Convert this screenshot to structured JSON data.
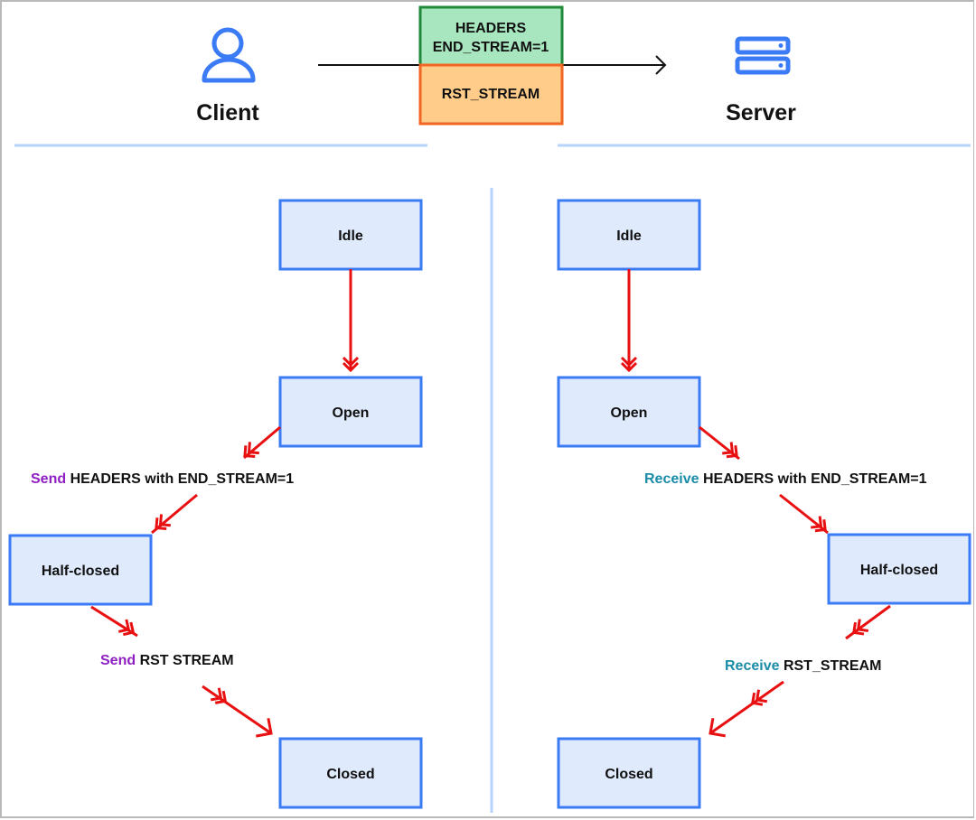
{
  "actors": {
    "client": {
      "label": "Client",
      "icon": "user-icon"
    },
    "server": {
      "label": "Server",
      "icon": "server-icon"
    }
  },
  "frames": [
    {
      "line1": "HEADERS",
      "line2": "END_STREAM=1",
      "fill": "#a8e6bf",
      "stroke": "#1f8a3a"
    },
    {
      "line1": "RST_STREAM",
      "line2": "",
      "fill": "#ffcc8a",
      "stroke": "#f26522"
    }
  ],
  "client_states": [
    "Idle",
    "Open",
    "Half-closed",
    "Closed"
  ],
  "server_states": [
    "Idle",
    "Open",
    "Half-closed",
    "Closed"
  ],
  "client_transitions": [
    {
      "verb": "Send",
      "text": "HEADERS with END_STREAM=1"
    },
    {
      "verb": "Send",
      "text": "RST STREAM"
    }
  ],
  "server_transitions": [
    {
      "verb": "Receive",
      "text": "HEADERS with END_STREAM=1"
    },
    {
      "verb": "Receive",
      "text": "RST_STREAM"
    }
  ],
  "colors": {
    "state_fill": "#dfeafd",
    "state_stroke": "#3b7bf6",
    "arrow": "#e81010",
    "send_verb": "#8f1fc2",
    "receive_verb": "#1b8ca8",
    "divider": "#b6d3fb",
    "icon": "#3b7bf6"
  }
}
